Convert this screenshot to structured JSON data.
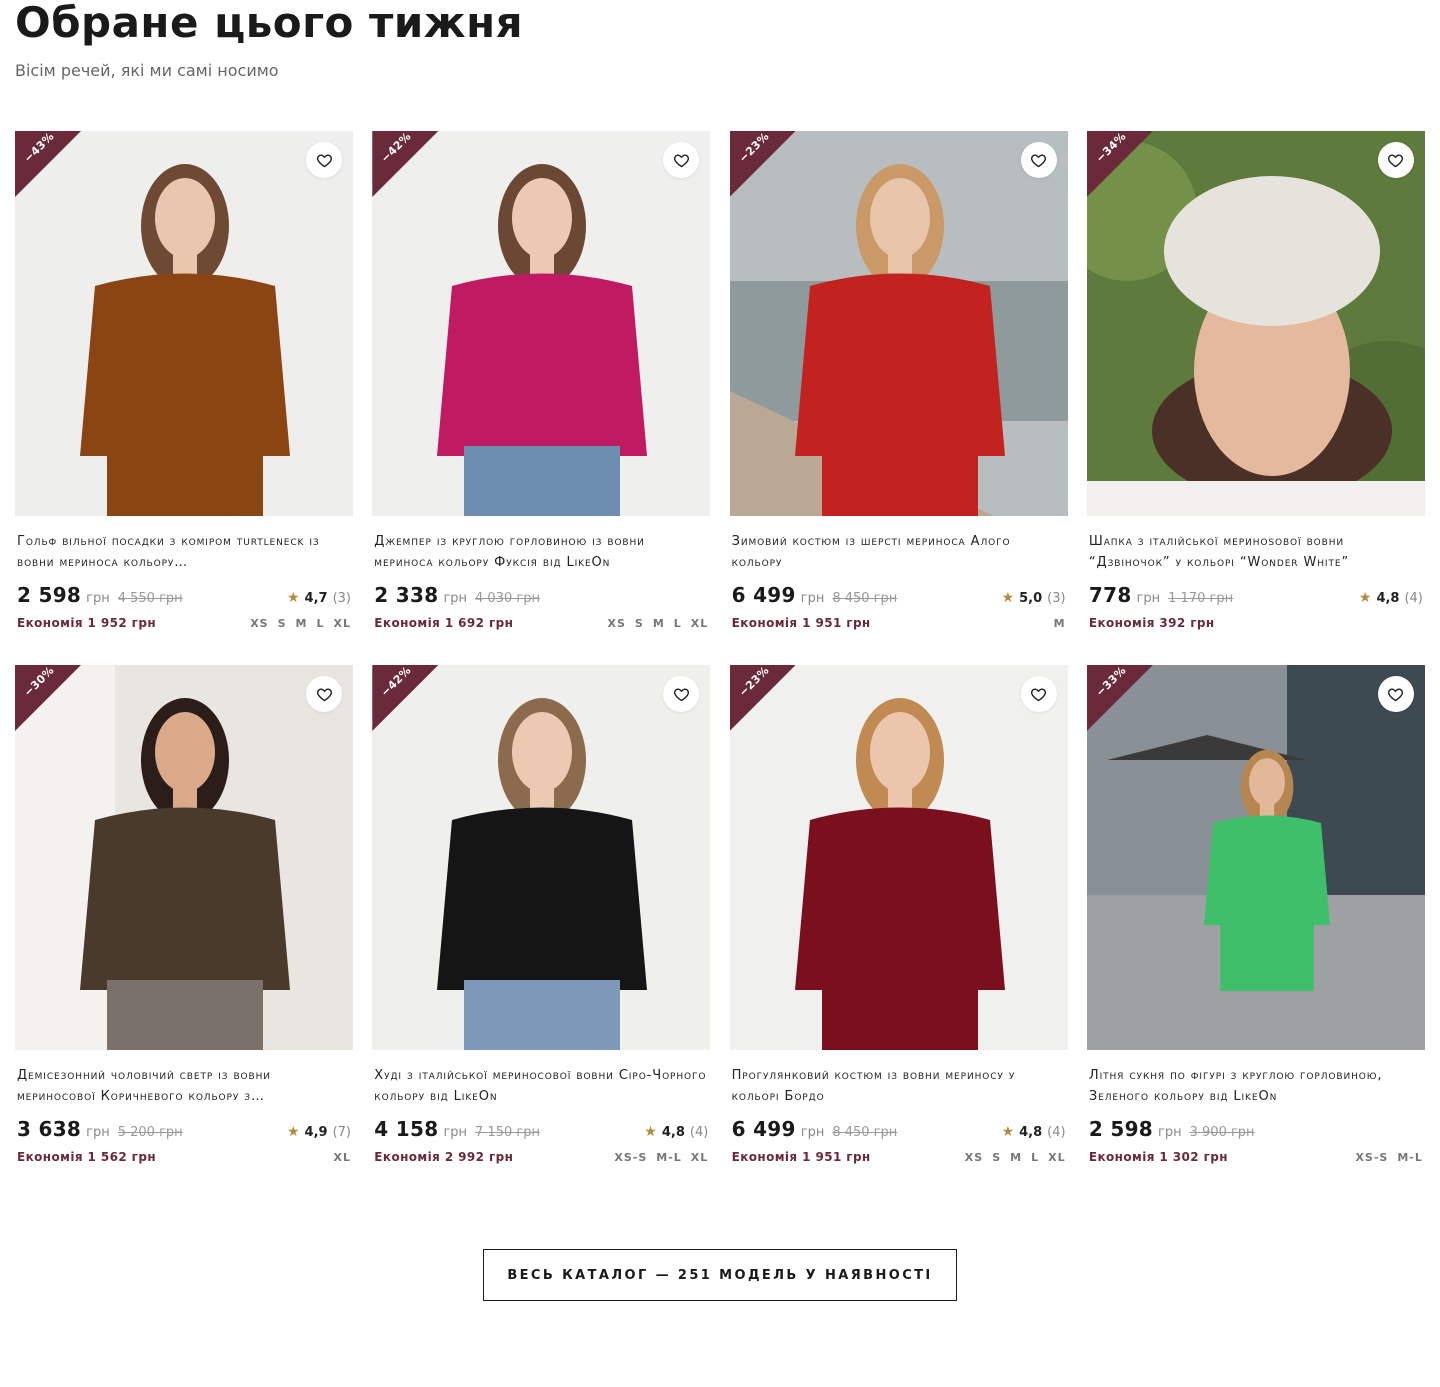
{
  "header": {
    "title": "Обране цього тижня",
    "subtitle": "Вісім речей, які ми самі носимо"
  },
  "colors": {
    "ribbon": "#6b2a3a",
    "savings": "#6b2a3a",
    "star": "#b58b3a"
  },
  "products": [
    {
      "discount": "−43%",
      "name": "Гольф вільної посадки з коміром turtleneck із вовни мериноса кольору…",
      "price": "2 598",
      "currency": "грн",
      "old_price": "4 550 грн",
      "rating": "4,7",
      "reviews": "(3)",
      "savings": "Економія 1 952 грн",
      "sizes": [
        "XS",
        "S",
        "M",
        "L",
        "XL"
      ],
      "scene": {
        "bg": "#eeeeec",
        "garment": "#8a4512",
        "skin": "#e9c6ae",
        "hair": "#6e4a34",
        "legs": "#8a4512"
      }
    },
    {
      "discount": "−42%",
      "name": "Джемпер із круглою горловиною із вовни мериноса кольору Фуксія від LikeOn",
      "price": "2 338",
      "currency": "грн",
      "old_price": "4 030 грн",
      "rating": "",
      "reviews": "",
      "savings": "Економія 1 692 грн",
      "sizes": [
        "XS",
        "S",
        "M",
        "L",
        "XL"
      ],
      "scene": {
        "bg": "#efefed",
        "garment": "#c01a62",
        "skin": "#ecc9b3",
        "hair": "#6a4834",
        "legs": "#6e8eb0"
      }
    },
    {
      "discount": "−23%",
      "name": "Зимовий костюм із шерсті мериноса Алого кольору",
      "price": "6 499",
      "currency": "грн",
      "old_price": "8 450 грн",
      "rating": "5,0",
      "reviews": "(3)",
      "savings": "Економія 1 951 грн",
      "sizes": [
        "M"
      ],
      "scene": {
        "bg": "#b8bec0",
        "garment": "#c2231f",
        "skin": "#e8c4a8",
        "hair": "#c99a68",
        "legs": "#c2231f"
      }
    },
    {
      "discount": "−34%",
      "name": "Шапка з італійської меринosової вовни “Дзвіночок” у кольорі “Wonder White”",
      "price": "778",
      "currency": "грн",
      "old_price": "1 170 грн",
      "rating": "4,8",
      "reviews": "(4)",
      "savings": "Економія 392 грн",
      "sizes": [],
      "scene": {
        "bg": "#5e7a3c",
        "garment": "#e6e3dd",
        "skin": "#e4b99e",
        "hair": "#4a3026",
        "legs": "#e6e3dd"
      }
    },
    {
      "discount": "−30%",
      "name": "Демісезонний чоловічий светр із вовни мериносової Коричневого кольору з…",
      "price": "3 638",
      "currency": "грн",
      "old_price": "5 200 грн",
      "rating": "4,9",
      "reviews": "(7)",
      "savings": "Економія 1 562 грн",
      "sizes": [
        "XL"
      ],
      "scene": {
        "bg": "#e9e6e1",
        "garment": "#4a3a2c",
        "skin": "#d9a98a",
        "hair": "#2b1e18",
        "legs": "#7a716a"
      }
    },
    {
      "discount": "−42%",
      "name": "Худі з італійської мериносової вовни Сіро-Чорного кольору від LikeOn",
      "price": "4 158",
      "currency": "грн",
      "old_price": "7 150 грн",
      "rating": "4,8",
      "reviews": "(4)",
      "savings": "Економія 2 992 грн",
      "sizes": [
        "XS-S",
        "M-L",
        "XL"
      ],
      "scene": {
        "bg": "#efefec",
        "garment": "#151515",
        "skin": "#ecc9b3",
        "hair": "#8c6a4e",
        "legs": "#7d98b8"
      }
    },
    {
      "discount": "−23%",
      "name": "Прогулянковий костюм із вовни мериносу у кольорі Бордо",
      "price": "6 499",
      "currency": "грн",
      "old_price": "8 450 грн",
      "rating": "4,8",
      "reviews": "(4)",
      "savings": "Економія 1 951 грн",
      "sizes": [
        "XS",
        "S",
        "M",
        "L",
        "XL"
      ],
      "scene": {
        "bg": "#f0f0ee",
        "garment": "#7a0f1e",
        "skin": "#ecc6ac",
        "hair": "#c08a52",
        "legs": "#7a0f1e"
      }
    },
    {
      "discount": "−33%",
      "name": "Літня сукня по фігурі з круглою горловиною, Зеленого кольору від LikeOn",
      "price": "2 598",
      "currency": "грн",
      "old_price": "3 900 грн",
      "rating": "",
      "reviews": "",
      "savings": "Економія 1 302 грн",
      "sizes": [
        "XS-S",
        "M-L"
      ],
      "scene": {
        "bg": "#8a9196",
        "garment": "#3fbf6a",
        "skin": "#e3b899",
        "hair": "#b58552",
        "legs": "#3fbf6a"
      }
    }
  ],
  "catalog_button": {
    "label": "ВЕСЬ КАТАЛОГ — 251 МОДЕЛЬ У НАЯВНОСТІ"
  }
}
